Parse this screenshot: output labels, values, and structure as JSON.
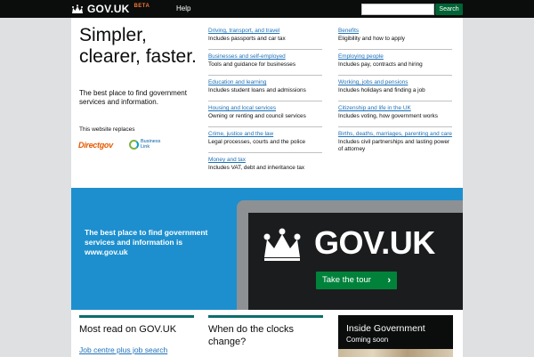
{
  "header": {
    "brand": "GOV.UK",
    "badge": "BETA",
    "help_label": "Help",
    "search_value": "",
    "search_button": "Search"
  },
  "hero": {
    "title": "Simpler, clearer, faster.",
    "subtitle": "The best place to find government services and information.",
    "replaces_text": "This website replaces",
    "logos": {
      "directgov": "Directgov",
      "business_link": "Business Link"
    }
  },
  "topics": {
    "left": [
      {
        "link": "Driving, transport, and travel",
        "desc": "Includes passports and car tax"
      },
      {
        "link": "Businesses and self-employed",
        "desc": "Tools and guidance for businesses"
      },
      {
        "link": "Education and learning",
        "desc": "Includes student loans and admissions"
      },
      {
        "link": "Housing and local services",
        "desc": "Owning or renting and council services"
      },
      {
        "link": "Crime, justice and the law",
        "desc": "Legal processes, courts and the police"
      },
      {
        "link": "Money and tax",
        "desc": "Includes VAT, debt and inheritance tax"
      }
    ],
    "right": [
      {
        "link": "Benefits",
        "desc": "Eligibility and how to apply"
      },
      {
        "link": "Employing people",
        "desc": "Includes pay, contracts and hiring"
      },
      {
        "link": "Working, jobs and pensions",
        "desc": "Includes holidays and finding a job"
      },
      {
        "link": "Citizenship and life in the UK",
        "desc": "Includes voting, how government works"
      },
      {
        "link": "Births, deaths, marriages, parenting and care",
        "desc": "Includes civil partnerships and lasting power of attorney"
      }
    ]
  },
  "promo": {
    "text": "The best place to find government services and information is www.gov.uk",
    "screen_logo": "GOV.UK",
    "tour_button": "Take the tour",
    "tour_arrow": "›"
  },
  "sections": {
    "most_read": {
      "title": "Most read on GOV.UK",
      "first_link": "Job centre plus job search"
    },
    "clocks": {
      "title": "When do the clocks change?"
    },
    "inside_gov": {
      "title": "Inside Government",
      "subtitle": "Coming soon"
    }
  },
  "colors": {
    "header_bg": "#0b0c0c",
    "link": "#1d70b8",
    "search_button": "#006435",
    "promo_bg": "#1d8fce",
    "tour_button": "#00823b",
    "section_rule": "#0b6e6d",
    "beta": "#f47738"
  },
  "icons": [
    "crown-icon",
    "business-link-logo-icon",
    "chevron-right-icon"
  ]
}
